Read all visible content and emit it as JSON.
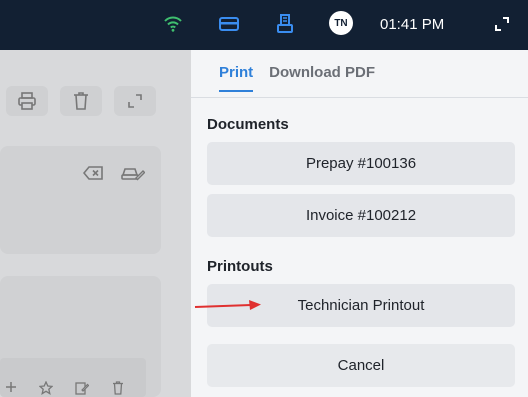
{
  "topbar": {
    "icons": [
      "wifi-icon",
      "card-icon",
      "printer-icon",
      "expand-icon"
    ],
    "avatar_initials": "TN",
    "time": "01:41 PM"
  },
  "background": {
    "icons": [
      "print-icon",
      "trash-icon",
      "expand-icon",
      "backspace-icon",
      "edit-car-icon",
      "plus-icon",
      "star-icon",
      "edit-icon",
      "trash-icon"
    ]
  },
  "panel": {
    "tabs": [
      {
        "label": "Print",
        "active": true
      },
      {
        "label": "Download PDF",
        "active": false
      }
    ],
    "documents_heading": "Documents",
    "documents": [
      "Prepay #100136",
      "Invoice #100212"
    ],
    "printouts_heading": "Printouts",
    "printouts": [
      "Technician Printout"
    ],
    "cancel_label": "Cancel"
  },
  "colors": {
    "topbar": "#122033",
    "accent": "#2f80d9",
    "wifi": "#3fbf6f",
    "arrow": "#e03030"
  }
}
